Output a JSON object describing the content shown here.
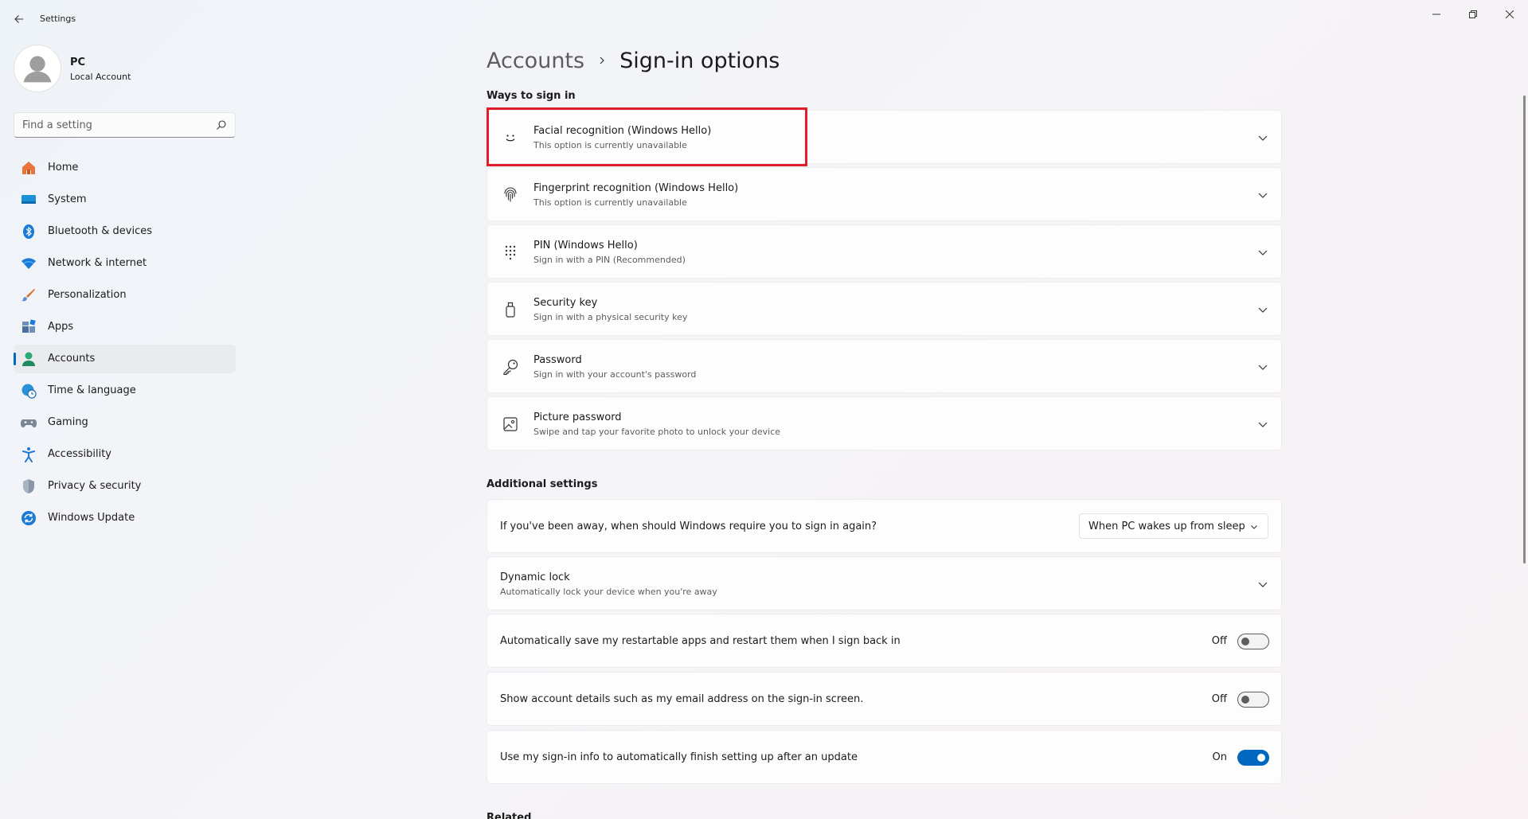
{
  "window": {
    "title": "Settings"
  },
  "profile": {
    "name": "PC",
    "account_type": "Local Account"
  },
  "search": {
    "placeholder": "Find a setting"
  },
  "sidebar": {
    "items": [
      {
        "label": "Home",
        "icon": "home-icon"
      },
      {
        "label": "System",
        "icon": "system-icon"
      },
      {
        "label": "Bluetooth & devices",
        "icon": "bluetooth-icon"
      },
      {
        "label": "Network & internet",
        "icon": "wifi-icon"
      },
      {
        "label": "Personalization",
        "icon": "brush-icon"
      },
      {
        "label": "Apps",
        "icon": "apps-icon"
      },
      {
        "label": "Accounts",
        "icon": "accounts-icon",
        "active": true
      },
      {
        "label": "Time & language",
        "icon": "globe-clock-icon"
      },
      {
        "label": "Gaming",
        "icon": "gamepad-icon"
      },
      {
        "label": "Accessibility",
        "icon": "accessibility-icon"
      },
      {
        "label": "Privacy & security",
        "icon": "shield-icon"
      },
      {
        "label": "Windows Update",
        "icon": "update-icon"
      }
    ]
  },
  "breadcrumb": {
    "parent": "Accounts",
    "current": "Sign-in options"
  },
  "ways_to_sign_in": {
    "title": "Ways to sign in",
    "items": [
      {
        "title": "Facial recognition (Windows Hello)",
        "subtitle": "This option is currently unavailable",
        "icon": "face-icon"
      },
      {
        "title": "Fingerprint recognition (Windows Hello)",
        "subtitle": "This option is currently unavailable",
        "icon": "fingerprint-icon"
      },
      {
        "title": "PIN (Windows Hello)",
        "subtitle": "Sign in with a PIN (Recommended)",
        "icon": "keypad-icon"
      },
      {
        "title": "Security key",
        "subtitle": "Sign in with a physical security key",
        "icon": "usb-key-icon"
      },
      {
        "title": "Password",
        "subtitle": "Sign in with your account's password",
        "icon": "key-icon"
      },
      {
        "title": "Picture password",
        "subtitle": "Swipe and tap your favorite photo to unlock your device",
        "icon": "picture-icon"
      }
    ]
  },
  "additional_settings": {
    "title": "Additional settings",
    "require_sign_in": {
      "label": "If you've been away, when should Windows require you to sign in again?",
      "value": "When PC wakes up from sleep"
    },
    "dynamic_lock": {
      "title": "Dynamic lock",
      "subtitle": "Automatically lock your device when you're away"
    },
    "restart_apps": {
      "label": "Automatically save my restartable apps and restart them when I sign back in",
      "state": "Off",
      "on": false
    },
    "account_details": {
      "label": "Show account details such as my email address on the sign-in screen.",
      "state": "Off",
      "on": false
    },
    "use_sign_in_info": {
      "label": "Use my sign-in info to automatically finish setting up after an update",
      "state": "On",
      "on": true
    }
  },
  "related": {
    "title": "Related"
  },
  "colors": {
    "accent": "#0067c0",
    "highlight": "#e01e2b"
  }
}
